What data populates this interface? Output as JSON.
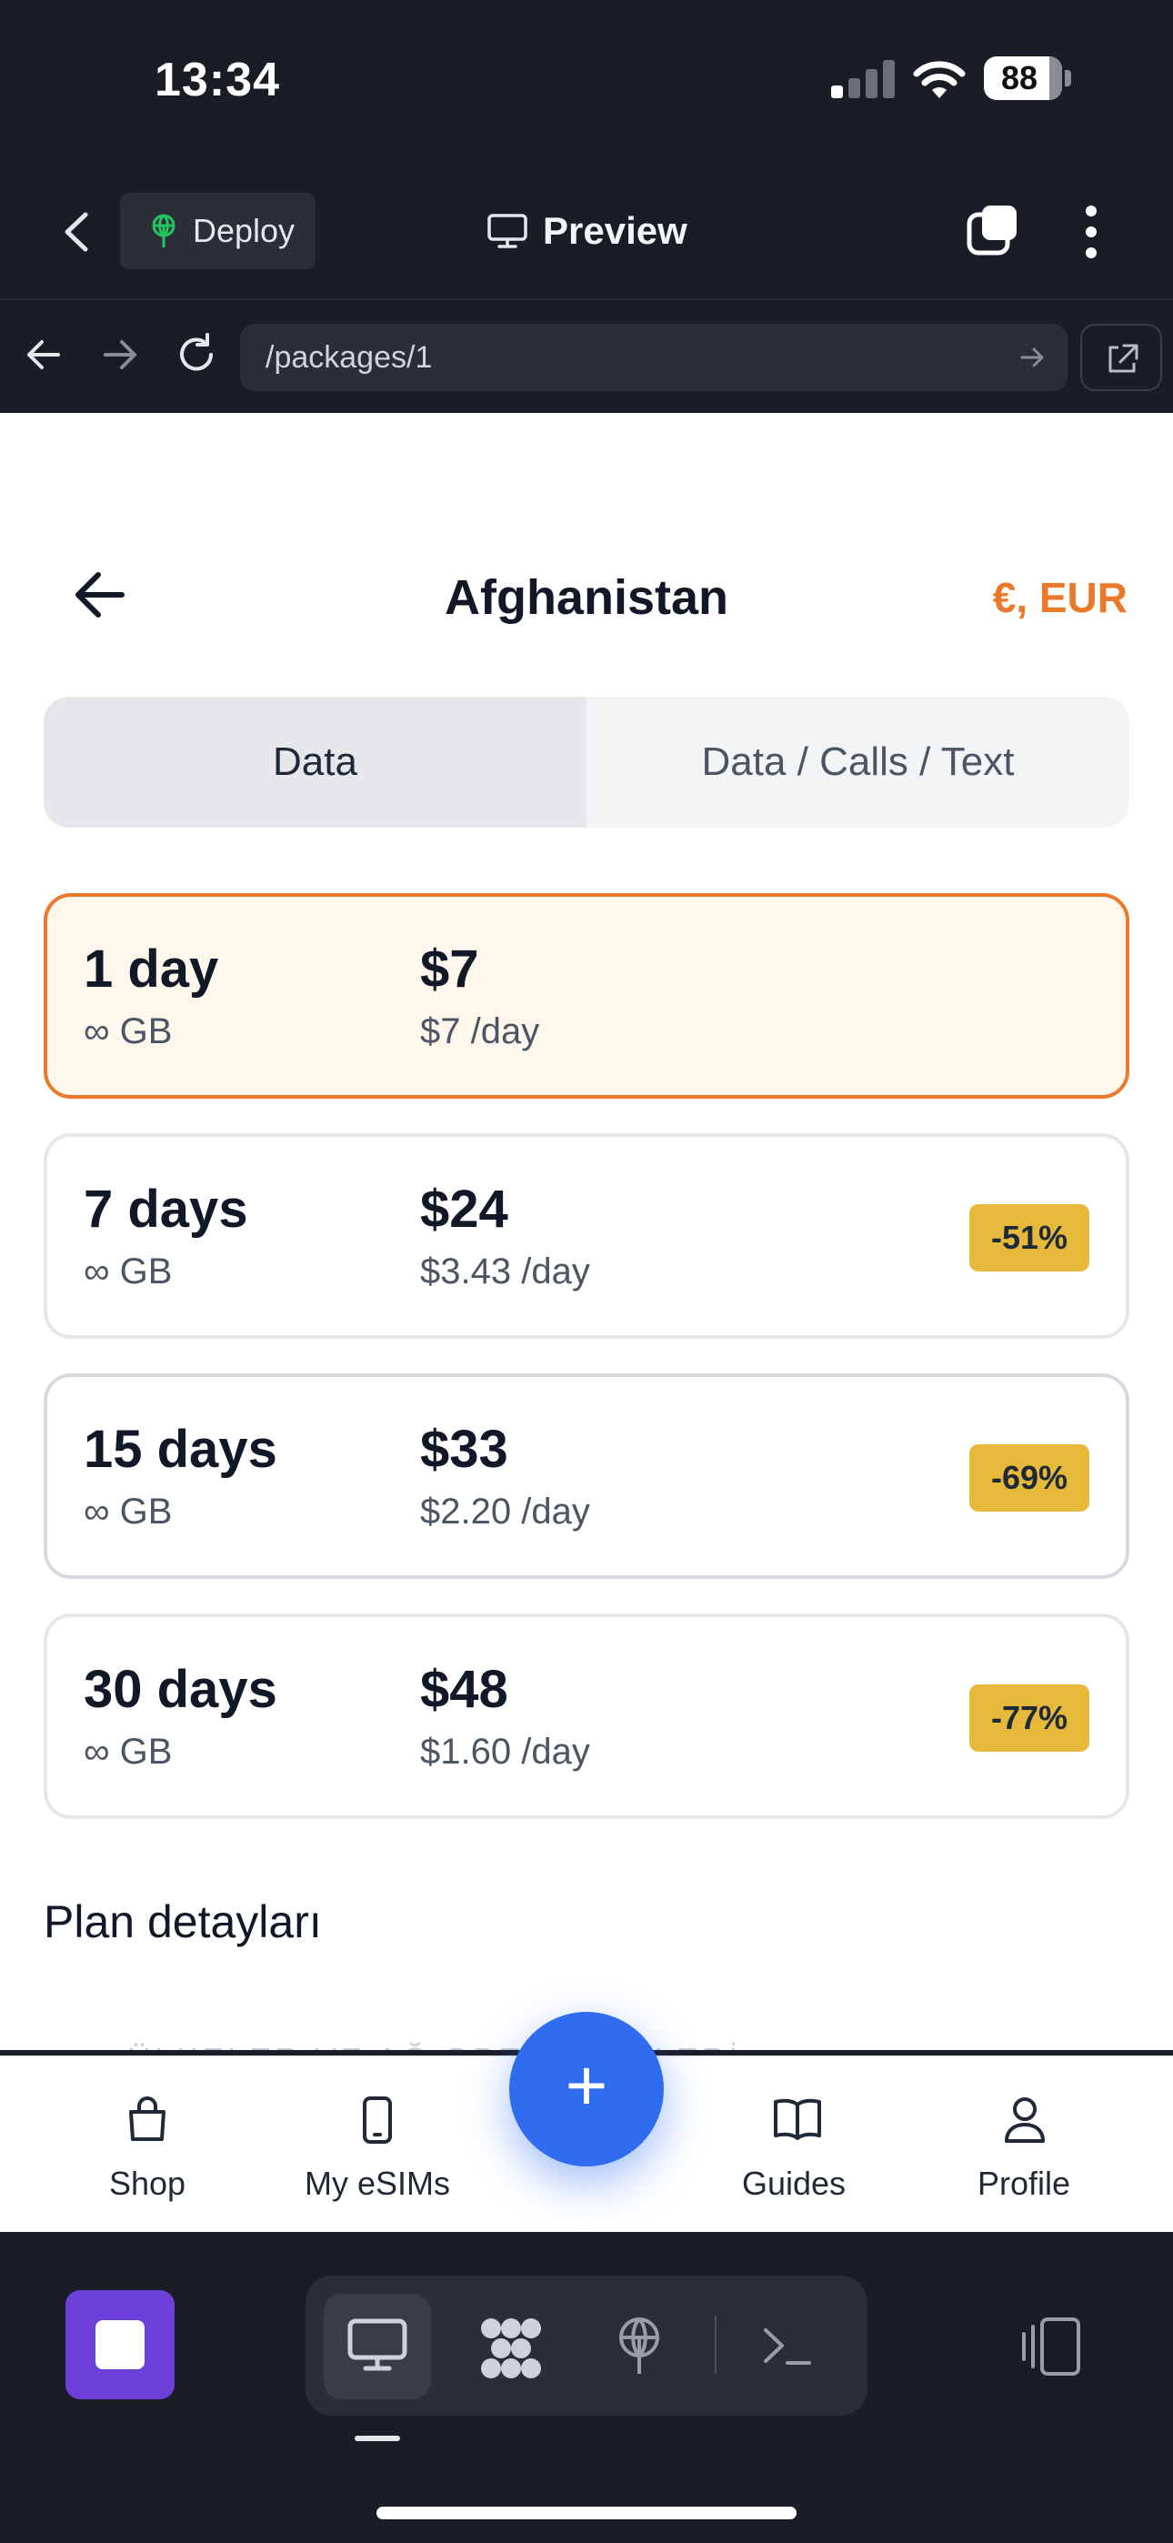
{
  "status_bar": {
    "time": "13:34",
    "battery": "88"
  },
  "header": {
    "deploy_label": "Deploy",
    "preview_label": "Preview"
  },
  "browser": {
    "url": "/packages/1"
  },
  "page": {
    "title": "Afghanistan",
    "currency": "€, EUR",
    "tabs": [
      {
        "label": "Data",
        "active": true
      },
      {
        "label": "Data / Calls / Text",
        "active": false
      }
    ],
    "packages": [
      {
        "days": "1 day",
        "data": "∞ GB",
        "price": "$7",
        "per_day": "$7 /day",
        "discount": "",
        "selected": true
      },
      {
        "days": "7 days",
        "data": "∞ GB",
        "price": "$24",
        "per_day": "$3.43 /day",
        "discount": "-51%",
        "selected": false
      },
      {
        "days": "15 days",
        "data": "∞ GB",
        "price": "$33",
        "per_day": "$2.20 /day",
        "discount": "-69%",
        "selected": false
      },
      {
        "days": "30 days",
        "data": "∞ GB",
        "price": "$48",
        "per_day": "$1.60 /day",
        "discount": "-77%",
        "selected": false
      }
    ],
    "plan_details_heading": "Plan detayları",
    "faded_text": "ÜLKELER VE AĞ OPERATÖRLERİ"
  },
  "tabbar": {
    "items": [
      {
        "label": "Shop",
        "icon": "shopping-bag-icon"
      },
      {
        "label": "My eSIMs",
        "icon": "phone-icon"
      },
      {
        "label": "Guides",
        "icon": "book-icon"
      },
      {
        "label": "Profile",
        "icon": "user-icon"
      }
    ],
    "fab": "+"
  },
  "colors": {
    "accent": "#ea7a2a",
    "selected_bg": "#fff6ec",
    "badge": "#e6b93a",
    "fab": "#2f6cf0",
    "chrome_bg": "#1b1d26",
    "stop_button": "#6d3fd9"
  }
}
